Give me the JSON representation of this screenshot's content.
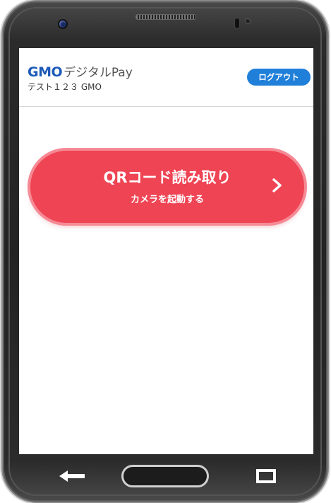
{
  "header": {
    "logo_brand": "GMO",
    "logo_product": "デジタルPay",
    "store_name": "テスト１２３ GMO",
    "logout_label": "ログアウト"
  },
  "qr_button": {
    "title": "QRコード読み取り",
    "subtitle": "カメラを起動する",
    "icon": "chevron-right-icon"
  },
  "nav_bar": {
    "back_icon": "back-arrow-icon",
    "home_icon": "home-button",
    "recent_icon": "recent-apps-icon"
  },
  "colors": {
    "brand_blue": "#1e5bb8",
    "logout_blue": "#1f7fd9",
    "qr_red": "#ef4454",
    "qr_ring": "#f58a95"
  }
}
